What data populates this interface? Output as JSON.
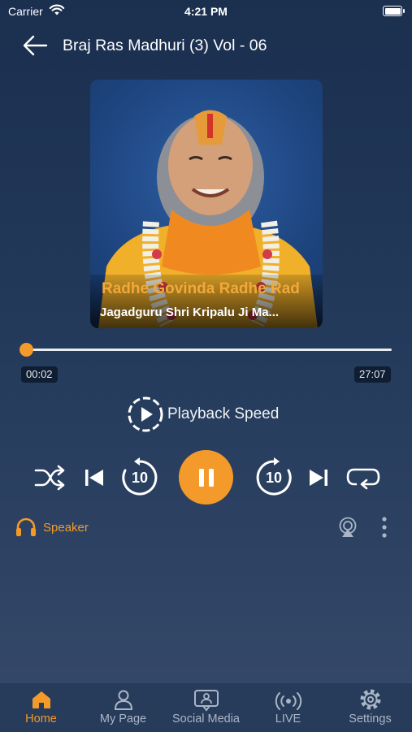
{
  "status_bar": {
    "carrier": "Carrier",
    "time": "4:21 PM"
  },
  "header": {
    "title": "Braj Ras Madhuri (3) Vol - 06"
  },
  "artwork": {
    "line1": "Radhe Govinda Radhe Rad",
    "line2": "Jagadguru Shri Kripalu Ji Ma..."
  },
  "player": {
    "elapsed": "00:02",
    "duration": "27:07",
    "progress_fraction": 0.0012,
    "playback_speed_label": "Playback Speed",
    "skip_back_seconds": "10",
    "skip_forward_seconds": "10",
    "state": "playing"
  },
  "output": {
    "speaker_label": "Speaker"
  },
  "tabs": [
    {
      "label": "Home",
      "icon": "home-icon",
      "active": true
    },
    {
      "label": "My Page",
      "icon": "person-icon",
      "active": false
    },
    {
      "label": "Social Media",
      "icon": "social-chat-icon",
      "active": false
    },
    {
      "label": "LIVE",
      "icon": "live-broadcast-icon",
      "active": false
    },
    {
      "label": "Settings",
      "icon": "gear-icon",
      "active": false
    }
  ],
  "colors": {
    "accent": "#f39a2b",
    "background_top": "#1b2f4f",
    "background_bottom": "#36496a"
  }
}
